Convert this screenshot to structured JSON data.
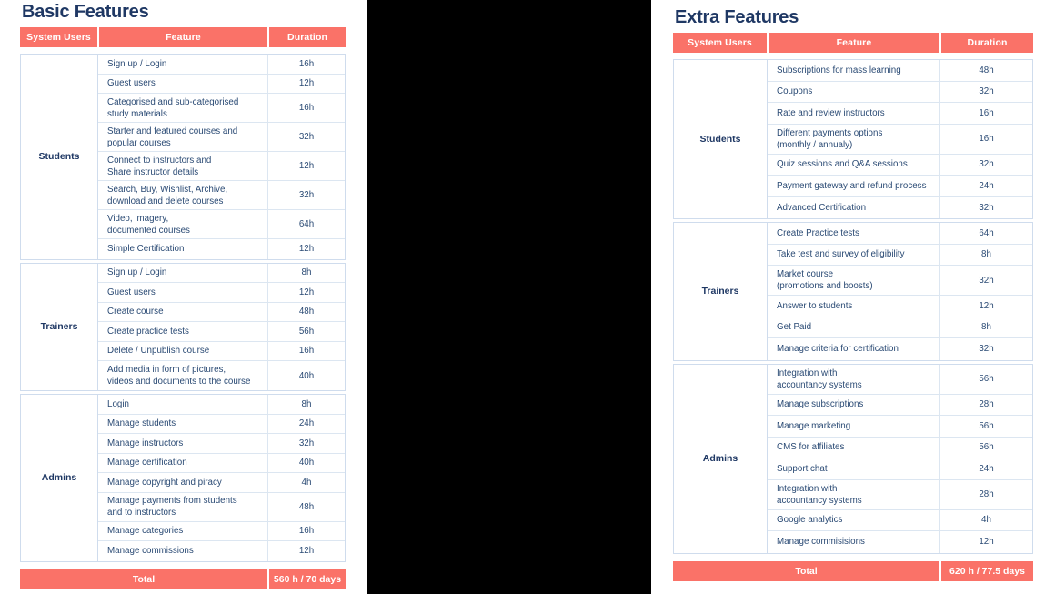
{
  "colors": {
    "accent": "#fa7268",
    "title": "#1f3864",
    "text": "#2a4a74",
    "border": "#cfdced",
    "row_border": "#dce6f1",
    "panel_black": "#000000",
    "white": "#ffffff"
  },
  "columns": {
    "system_users": "System Users",
    "feature": "Feature",
    "duration": "Duration"
  },
  "total_label": "Total",
  "left_table": {
    "title": "Basic Features",
    "groups": [
      {
        "user": "Students",
        "rows": [
          {
            "feature": "Sign up / Login",
            "duration": "16h",
            "lines": 1
          },
          {
            "feature": "Guest users",
            "duration": "12h",
            "lines": 1
          },
          {
            "feature": "Categorised and sub-categorised\nstudy materials",
            "duration": "16h",
            "lines": 2
          },
          {
            "feature": "Starter and featured courses and\npopular courses",
            "duration": "32h",
            "lines": 2
          },
          {
            "feature": "Connect to instructors and\nShare instructor details",
            "duration": "12h",
            "lines": 2
          },
          {
            "feature": "Search, Buy, Wishlist, Archive,\ndownload and delete courses",
            "duration": "32h",
            "lines": 2
          },
          {
            "feature": "Video, imagery,\ndocumented courses",
            "duration": "64h",
            "lines": 2
          },
          {
            "feature": "Simple Certification",
            "duration": "12h",
            "lines": 1
          }
        ]
      },
      {
        "user": "Trainers",
        "rows": [
          {
            "feature": "Sign up / Login",
            "duration": "8h",
            "lines": 1
          },
          {
            "feature": "Guest users",
            "duration": "12h",
            "lines": 1
          },
          {
            "feature": "Create course",
            "duration": "48h",
            "lines": 1
          },
          {
            "feature": "Create practice tests",
            "duration": "56h",
            "lines": 1
          },
          {
            "feature": "Delete / Unpublish course",
            "duration": "16h",
            "lines": 1
          },
          {
            "feature": "Add media in form of pictures,\nvideos and documents to the course",
            "duration": "40h",
            "lines": 2
          }
        ]
      },
      {
        "user": "Admins",
        "rows": [
          {
            "feature": "Login",
            "duration": "8h",
            "lines": 1
          },
          {
            "feature": "Manage students",
            "duration": "24h",
            "lines": 1
          },
          {
            "feature": "Manage instructors",
            "duration": "32h",
            "lines": 1
          },
          {
            "feature": "Manage certification",
            "duration": "40h",
            "lines": 1
          },
          {
            "feature": "Manage copyright and piracy",
            "duration": "4h",
            "lines": 1
          },
          {
            "feature": "Manage payments from students\nand to instructors",
            "duration": "48h",
            "lines": 2
          },
          {
            "feature": "Manage categories",
            "duration": "16h",
            "lines": 1
          },
          {
            "feature": "Manage commissions",
            "duration": "12h",
            "lines": 1
          }
        ]
      }
    ],
    "total_value": "560 h / 70 days"
  },
  "right_table": {
    "title": "Extra Features",
    "groups": [
      {
        "user": "Students",
        "rows": [
          {
            "feature": "Subscriptions for mass learning",
            "duration": "48h",
            "lines": 1
          },
          {
            "feature": "Coupons",
            "duration": "32h",
            "lines": 1
          },
          {
            "feature": "Rate and review instructors",
            "duration": "16h",
            "lines": 1
          },
          {
            "feature": "Different payments options\n(monthly / annualy)",
            "duration": "16h",
            "lines": 2
          },
          {
            "feature": "Quiz sessions and Q&A sessions",
            "duration": "32h",
            "lines": 1
          },
          {
            "feature": "Payment gateway and refund process",
            "duration": "24h",
            "lines": 1
          },
          {
            "feature": "Advanced Certification",
            "duration": "32h",
            "lines": 1
          }
        ]
      },
      {
        "user": "Trainers",
        "rows": [
          {
            "feature": "Create Practice tests",
            "duration": "64h",
            "lines": 1
          },
          {
            "feature": "Take test and survey of eligibility",
            "duration": "8h",
            "lines": 1
          },
          {
            "feature": "Market course\n(promotions and boosts)",
            "duration": "32h",
            "lines": 2
          },
          {
            "feature": "Answer to students",
            "duration": "12h",
            "lines": 1
          },
          {
            "feature": "Get Paid",
            "duration": "8h",
            "lines": 1
          },
          {
            "feature": "Manage criteria for certification",
            "duration": "32h",
            "lines": 1
          }
        ]
      },
      {
        "user": "Admins",
        "rows": [
          {
            "feature": "Integration with\naccountancy systems",
            "duration": "56h",
            "lines": 2
          },
          {
            "feature": "Manage subscriptions",
            "duration": "28h",
            "lines": 1
          },
          {
            "feature": "Manage marketing",
            "duration": "56h",
            "lines": 1
          },
          {
            "feature": "CMS for affiliates",
            "duration": "56h",
            "lines": 1
          },
          {
            "feature": "Support chat",
            "duration": "24h",
            "lines": 1
          },
          {
            "feature": "Integration with\naccountancy systems",
            "duration": "28h",
            "lines": 2
          },
          {
            "feature": "Google analytics",
            "duration": "4h",
            "lines": 1
          },
          {
            "feature": "Manage commisisions",
            "duration": "12h",
            "lines": 1
          }
        ]
      }
    ],
    "total_value": "620 h / 77.5 days"
  }
}
